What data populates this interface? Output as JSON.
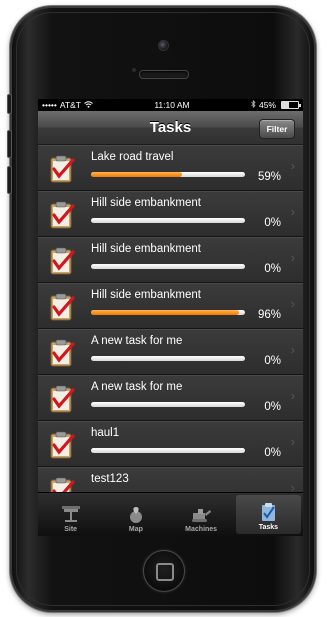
{
  "status_bar": {
    "carrier": "AT&T",
    "time": "11:10 AM",
    "battery": "45%"
  },
  "nav": {
    "title": "Tasks",
    "filter_label": "Filter"
  },
  "tasks": [
    {
      "name": "Lake road travel",
      "progress": 59,
      "progress_label": "59%"
    },
    {
      "name": "Hill side embankment",
      "progress": 0,
      "progress_label": "0%"
    },
    {
      "name": "Hill side embankment",
      "progress": 0,
      "progress_label": "0%"
    },
    {
      "name": "Hill side embankment",
      "progress": 96,
      "progress_label": "96%"
    },
    {
      "name": "A new task for me",
      "progress": 0,
      "progress_label": "0%"
    },
    {
      "name": "A new task for me",
      "progress": 0,
      "progress_label": "0%"
    },
    {
      "name": "haul1",
      "progress": 0,
      "progress_label": "0%"
    },
    {
      "name": "test123",
      "progress": 0,
      "progress_label": ""
    }
  ],
  "tabs": [
    {
      "label": "Site",
      "icon": "site-icon",
      "active": false
    },
    {
      "label": "Map",
      "icon": "map-icon",
      "active": false
    },
    {
      "label": "Machines",
      "icon": "machines-icon",
      "active": false
    },
    {
      "label": "Tasks",
      "icon": "tasks-icon",
      "active": true
    }
  ],
  "colors": {
    "progress_fill": "#f07a00",
    "progress_track": "#ffffff",
    "checkmark": "#d1161f"
  }
}
